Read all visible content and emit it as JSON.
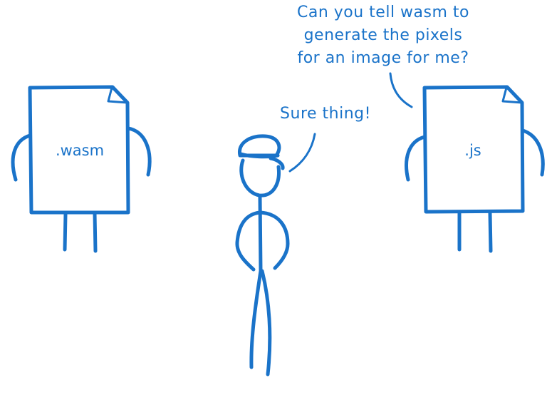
{
  "colors": {
    "ink": "#1a73c9",
    "background": "#ffffff"
  },
  "wasm_file": {
    "label": ".wasm"
  },
  "js_file": {
    "label": ".js"
  },
  "js_speech": {
    "lines": [
      "Can you tell wasm to",
      "generate the pixels",
      "for an image for me?"
    ]
  },
  "conductor_speech": {
    "text": "Sure thing!"
  }
}
